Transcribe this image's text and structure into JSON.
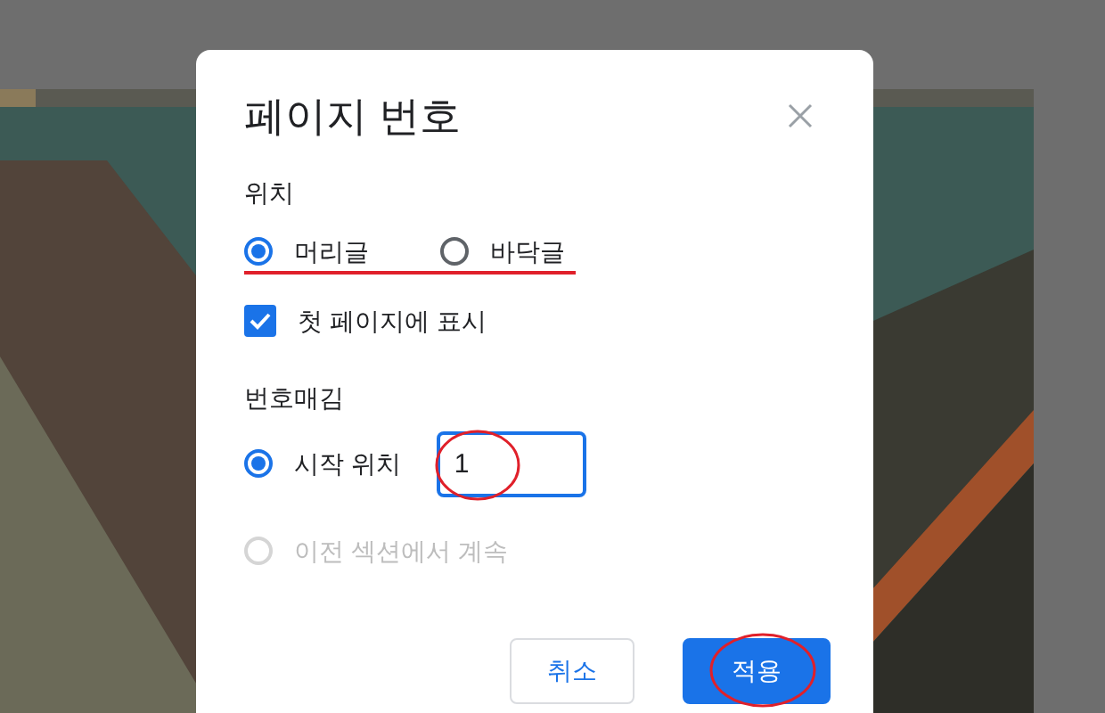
{
  "dialog": {
    "title": "페이지 번호",
    "position": {
      "heading": "위치",
      "options": [
        {
          "label": "머리글",
          "selected": true
        },
        {
          "label": "바닥글",
          "selected": false
        }
      ]
    },
    "first_page": {
      "label": "첫 페이지에 표시",
      "checked": true
    },
    "numbering": {
      "heading": "번호매김",
      "options": [
        {
          "label": "시작 위치",
          "selected": true,
          "disabled": false,
          "value": "1"
        },
        {
          "label": "이전 섹션에서 계속",
          "selected": false,
          "disabled": true
        }
      ]
    },
    "buttons": [
      {
        "label": "취소",
        "kind": "secondary"
      },
      {
        "label": "적용",
        "kind": "primary"
      }
    ]
  }
}
